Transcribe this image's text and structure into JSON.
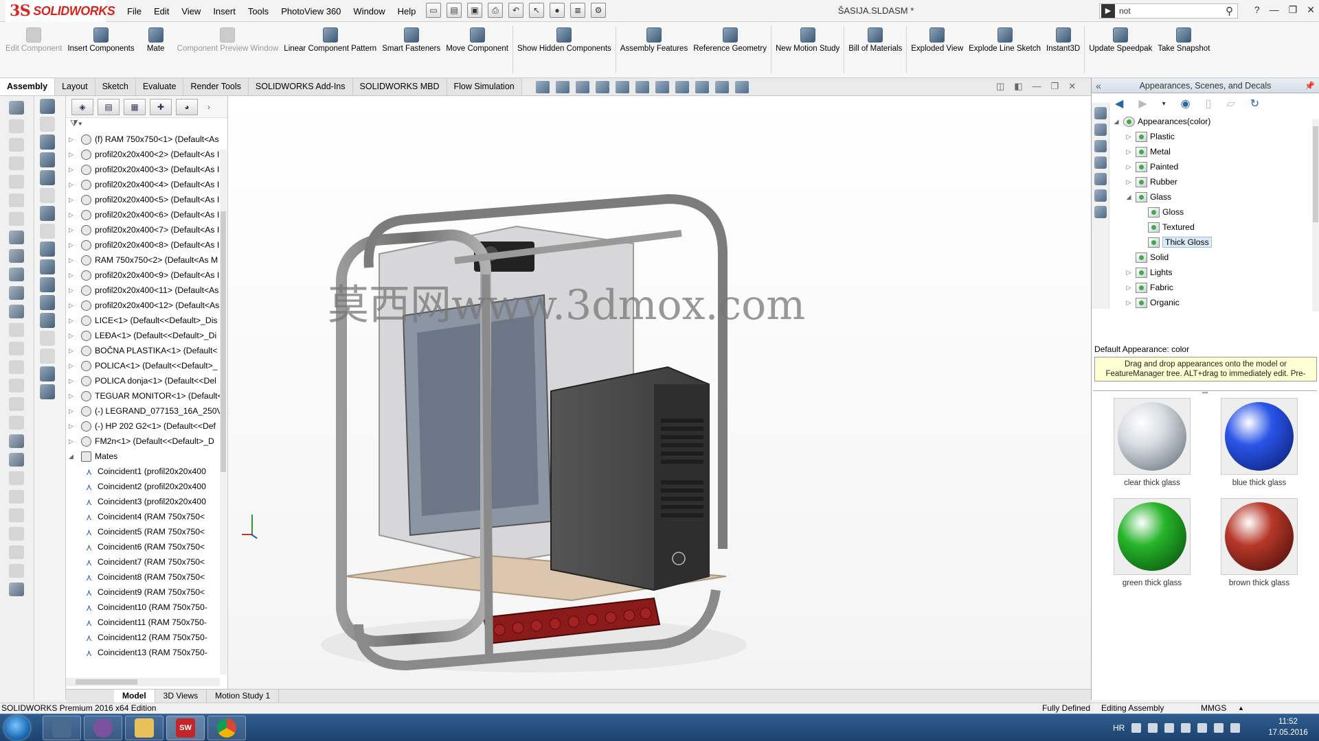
{
  "app": {
    "logo_ds": "3S",
    "logo_text": "SOLIDWORKS",
    "window_title": "ŠASIJA.SLDASM *",
    "menu": [
      "File",
      "Edit",
      "View",
      "Insert",
      "Tools",
      "PhotoView 360",
      "Window",
      "Help"
    ],
    "search_value": "not",
    "search_icon": "search-icon"
  },
  "ribbon": [
    {
      "label": "Edit Component",
      "enabled": false
    },
    {
      "label": "Insert Components",
      "enabled": true
    },
    {
      "label": "Mate",
      "enabled": true
    },
    {
      "label": "Component Preview Window",
      "enabled": false
    },
    {
      "label": "Linear Component Pattern",
      "enabled": true
    },
    {
      "label": "Smart Fasteners",
      "enabled": true
    },
    {
      "label": "Move Component",
      "enabled": true
    },
    {
      "label": "Show Hidden Components",
      "enabled": true
    },
    {
      "label": "Assembly Features",
      "enabled": true
    },
    {
      "label": "Reference Geometry",
      "enabled": true
    },
    {
      "label": "New Motion Study",
      "enabled": true
    },
    {
      "label": "Bill of Materials",
      "enabled": true
    },
    {
      "label": "Exploded View",
      "enabled": true
    },
    {
      "label": "Explode Line Sketch",
      "enabled": true
    },
    {
      "label": "Instant3D",
      "enabled": true
    },
    {
      "label": "Update Speedpak",
      "enabled": true
    },
    {
      "label": "Take Snapshot",
      "enabled": true
    }
  ],
  "command_tabs": [
    "Assembly",
    "Layout",
    "Sketch",
    "Evaluate",
    "Render Tools",
    "SOLIDWORKS Add-Ins",
    "SOLIDWORKS MBD",
    "Flow Simulation"
  ],
  "active_tab": "Assembly",
  "feature_tree": {
    "items": [
      "(f) RAM 750x750<1> (Default<As",
      "profil20x20x400<2> (Default<As I",
      "profil20x20x400<3> (Default<As I",
      "profil20x20x400<4> (Default<As I",
      "profil20x20x400<5> (Default<As I",
      "profil20x20x400<6> (Default<As I",
      "profil20x20x400<7> (Default<As I",
      "profil20x20x400<8> (Default<As I",
      "RAM 750x750<2> (Default<As M",
      "profil20x20x400<9> (Default<As I",
      "profil20x20x400<11> (Default<As",
      "profil20x20x400<12> (Default<As",
      "LICE<1> (Default<<Default>_Dis",
      "LEĐA<1> (Default<<Default>_Di",
      "BOČNA PLASTIKA<1> (Default<",
      "POLICA<1> (Default<<Default>_",
      "POLICA donja<1> (Default<<Del",
      "TEGUAR MONITOR<1> (Default<",
      "(-) LEGRAND_077153_16A_250V<",
      "(-) HP 202 G2<1> (Default<<Def",
      "FM2n<1> (Default<<Default>_D"
    ],
    "mates_label": "Mates",
    "mates": [
      "Coincident1 (profil20x20x400",
      "Coincident2 (profil20x20x400",
      "Coincident3 (profil20x20x400",
      "Coincident4 (RAM 750x750<",
      "Coincident5 (RAM 750x750<",
      "Coincident6 (RAM 750x750<",
      "Coincident7 (RAM 750x750<",
      "Coincident8 (RAM 750x750<",
      "Coincident9 (RAM 750x750<",
      "Coincident10 (RAM 750x750-",
      "Coincident11 (RAM 750x750-",
      "Coincident12 (RAM 750x750-",
      "Coincident13 (RAM 750x750-"
    ]
  },
  "watermark": "莫西网www.3dmox.com",
  "right_panel": {
    "title": "Appearances, Scenes, and Decals",
    "tree": [
      {
        "label": "Appearances(color)",
        "level": 0,
        "arrow": "◢"
      },
      {
        "label": "Plastic",
        "level": 1,
        "arrow": "▷"
      },
      {
        "label": "Metal",
        "level": 1,
        "arrow": "▷"
      },
      {
        "label": "Painted",
        "level": 1,
        "arrow": "▷"
      },
      {
        "label": "Rubber",
        "level": 1,
        "arrow": "▷"
      },
      {
        "label": "Glass",
        "level": 1,
        "arrow": "◢"
      },
      {
        "label": "Gloss",
        "level": 2,
        "arrow": ""
      },
      {
        "label": "Textured",
        "level": 2,
        "arrow": ""
      },
      {
        "label": "Thick Gloss",
        "level": 2,
        "arrow": "",
        "selected": true
      },
      {
        "label": "Solid",
        "level": 1,
        "arrow": ""
      },
      {
        "label": "Lights",
        "level": 1,
        "arrow": "▷"
      },
      {
        "label": "Fabric",
        "level": 1,
        "arrow": "▷"
      },
      {
        "label": "Organic",
        "level": 1,
        "arrow": "▷"
      },
      {
        "label": "Stone",
        "level": 1,
        "arrow": "▷"
      },
      {
        "label": "Miscellaneous",
        "level": 1,
        "arrow": "▷"
      }
    ],
    "default_label": "Default Appearance: color",
    "tip": "Drag and drop appearances onto the model or FeatureManager tree.  ALT+drag to immediately edit.  Pre-",
    "swatches": [
      {
        "label": "clear thick glass",
        "color": "#d8dde2",
        "shade": "#5a6570"
      },
      {
        "label": "blue thick glass",
        "color": "#2a55e8",
        "shade": "#061a6a"
      },
      {
        "label": "green thick glass",
        "color": "#27b52a",
        "shade": "#05440a"
      },
      {
        "label": "brown thick glass",
        "color": "#b8382a",
        "shade": "#3e0906"
      }
    ]
  },
  "view_tabs": [
    "Model",
    "3D Views",
    "Motion Study 1"
  ],
  "status": {
    "edition": "SOLIDWORKS Premium 2016 x64 Edition",
    "state": "Fully Defined",
    "mode": "Editing Assembly",
    "units": "MMGS"
  },
  "taskbar": {
    "apps": [
      "sw-icon",
      "chrome-icon"
    ],
    "sw_label": "SW",
    "lang": "HR",
    "time": "11:52",
    "date": "17.05.2016"
  }
}
